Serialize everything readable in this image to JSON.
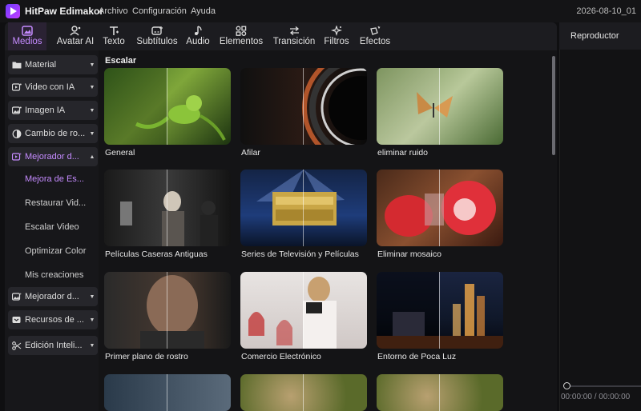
{
  "titlebar": {
    "app_name": "HitPaw Edimakor",
    "menus": [
      "Archivo",
      "Configuración",
      "Ayuda"
    ],
    "project_name": "2026-08-10_01"
  },
  "toolbar": {
    "tabs": [
      {
        "label": "Medios",
        "icon": "media-icon",
        "active": true
      },
      {
        "label": "Avatar AI",
        "icon": "avatar-icon"
      },
      {
        "label": "Texto",
        "icon": "text-icon"
      },
      {
        "label": "Subtítulos",
        "icon": "subtitles-icon"
      },
      {
        "label": "Audio",
        "icon": "audio-note-icon"
      },
      {
        "label": "Elementos",
        "icon": "elements-icon"
      },
      {
        "label": "Transición",
        "icon": "transition-icon"
      },
      {
        "label": "Filtros",
        "icon": "filters-icon"
      },
      {
        "label": "Efectos",
        "icon": "effects-icon"
      }
    ]
  },
  "sidebar": {
    "items": [
      {
        "label": "Material",
        "icon": "folder-icon"
      },
      {
        "label": "Video con IA",
        "icon": "ai-video-icon"
      },
      {
        "label": "Imagen IA",
        "icon": "ai-image-icon"
      },
      {
        "label": "Cambio de ro...",
        "icon": "face-swap-icon"
      },
      {
        "label": "Mejorador d...",
        "icon": "enhancer-icon",
        "expanded": true
      },
      {
        "label": "Mejorador d...",
        "icon": "photo-enhancer-icon"
      },
      {
        "label": "Recursos de ...",
        "icon": "resources-icon"
      },
      {
        "label": "Edición Inteli...",
        "icon": "smart-edit-icon"
      }
    ],
    "subitems": [
      "Mejora de Es...",
      "Restaurar Vid...",
      "Escalar Video",
      "Optimizar Color",
      "Mis creaciones"
    ]
  },
  "content": {
    "section_title": "Escalar",
    "cards": [
      {
        "label": "General"
      },
      {
        "label": "Afilar"
      },
      {
        "label": "eliminar ruido"
      },
      {
        "label": "Películas Caseras Antiguas"
      },
      {
        "label": "Series de Televisión y Películas"
      },
      {
        "label": "Eliminar mosaico"
      },
      {
        "label": "Primer plano de rostro"
      },
      {
        "label": "Comercio Electrónico"
      },
      {
        "label": "Entorno de Poca Luz"
      }
    ]
  },
  "player": {
    "title": "Reproductor",
    "time": "00:00:00 / 00:00:00"
  },
  "colors": {
    "accent": "#c58bff",
    "background": "#0f0f11",
    "panel": "#1c1c20"
  }
}
